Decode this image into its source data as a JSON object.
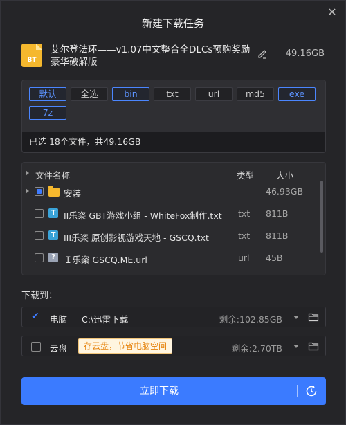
{
  "dialog": {
    "title": "新建下载任务",
    "close_icon": "close-icon"
  },
  "task": {
    "icon_label": "BT",
    "name": "艾尔登法环——v1.07中文整合全DLCs预购奖励豪华破解版",
    "size": "49.16GB"
  },
  "filters": {
    "chips": [
      {
        "label": "默认",
        "on": true
      },
      {
        "label": "全选",
        "on": false
      },
      {
        "label": "bin",
        "on": true
      },
      {
        "label": "txt",
        "on": false
      },
      {
        "label": "url",
        "on": false
      },
      {
        "label": "md5",
        "on": false
      },
      {
        "label": "exe",
        "on": true
      },
      {
        "label": "7z",
        "on": true
      }
    ],
    "selected_summary": "已选 18个文件，共49.16GB"
  },
  "file_list": {
    "headers": {
      "name": "文件名称",
      "type": "类型",
      "size": "大小"
    },
    "rows": [
      {
        "name": "安装",
        "type": "",
        "size": "46.93GB",
        "icon": "folder-icon"
      },
      {
        "name": "II乐栥 GBT游戏小组 - WhiteFox制作.txt",
        "type": "txt",
        "size": "811B",
        "icon": "txt-file-icon"
      },
      {
        "name": "III乐栥 原创影视游戏天地 - GSCQ.txt",
        "type": "txt",
        "size": "811B",
        "icon": "txt-file-icon"
      },
      {
        "name": "Ｉ乐栥 GSCQ.ME.url",
        "type": "url",
        "size": "45B",
        "icon": "url-file-icon"
      }
    ]
  },
  "download_to": {
    "label": "下载到：",
    "targets": [
      {
        "name": "电脑",
        "path": "C:\\迅雷下载",
        "free": "剩余:102.85GB",
        "checked": true
      },
      {
        "name": "云盘",
        "tip": "存云盘，节省电脑空间",
        "free": "剩余:2.70TB",
        "checked": false
      }
    ]
  },
  "actions": {
    "download_label": "立即下载"
  },
  "colors": {
    "accent": "#3b7bff",
    "folder": "#f5b82e",
    "tip_text": "#e6820a"
  }
}
